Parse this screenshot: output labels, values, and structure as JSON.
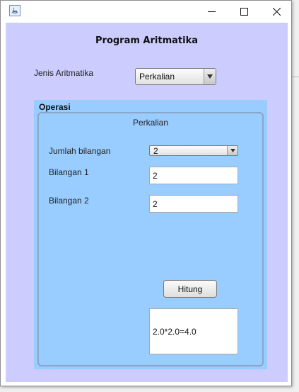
{
  "window": {
    "title": "",
    "controls": {
      "minimize_icon": "minimize-icon",
      "maximize_icon": "maximize-icon",
      "close_icon": "close-icon"
    }
  },
  "form": {
    "title": "Program Aritmatika",
    "jenis_label": "Jenis Aritmatika",
    "jenis_selected": "Perkalian"
  },
  "operasi": {
    "panel_title": "Operasi",
    "mode_title": "Perkalian",
    "jumlah_label": "Jumlah bilangan",
    "jumlah_selected": "2",
    "bilangan1_label": "Bilangan 1",
    "bilangan1_value": "2",
    "bilangan2_label": "Bilangan 2",
    "bilangan2_value": "2",
    "hitung_label": "Hitung",
    "result_text": "2.0*2.0=4.0"
  },
  "colors": {
    "client_bg": "#ccccff",
    "panel_bg": "#99ccff"
  }
}
